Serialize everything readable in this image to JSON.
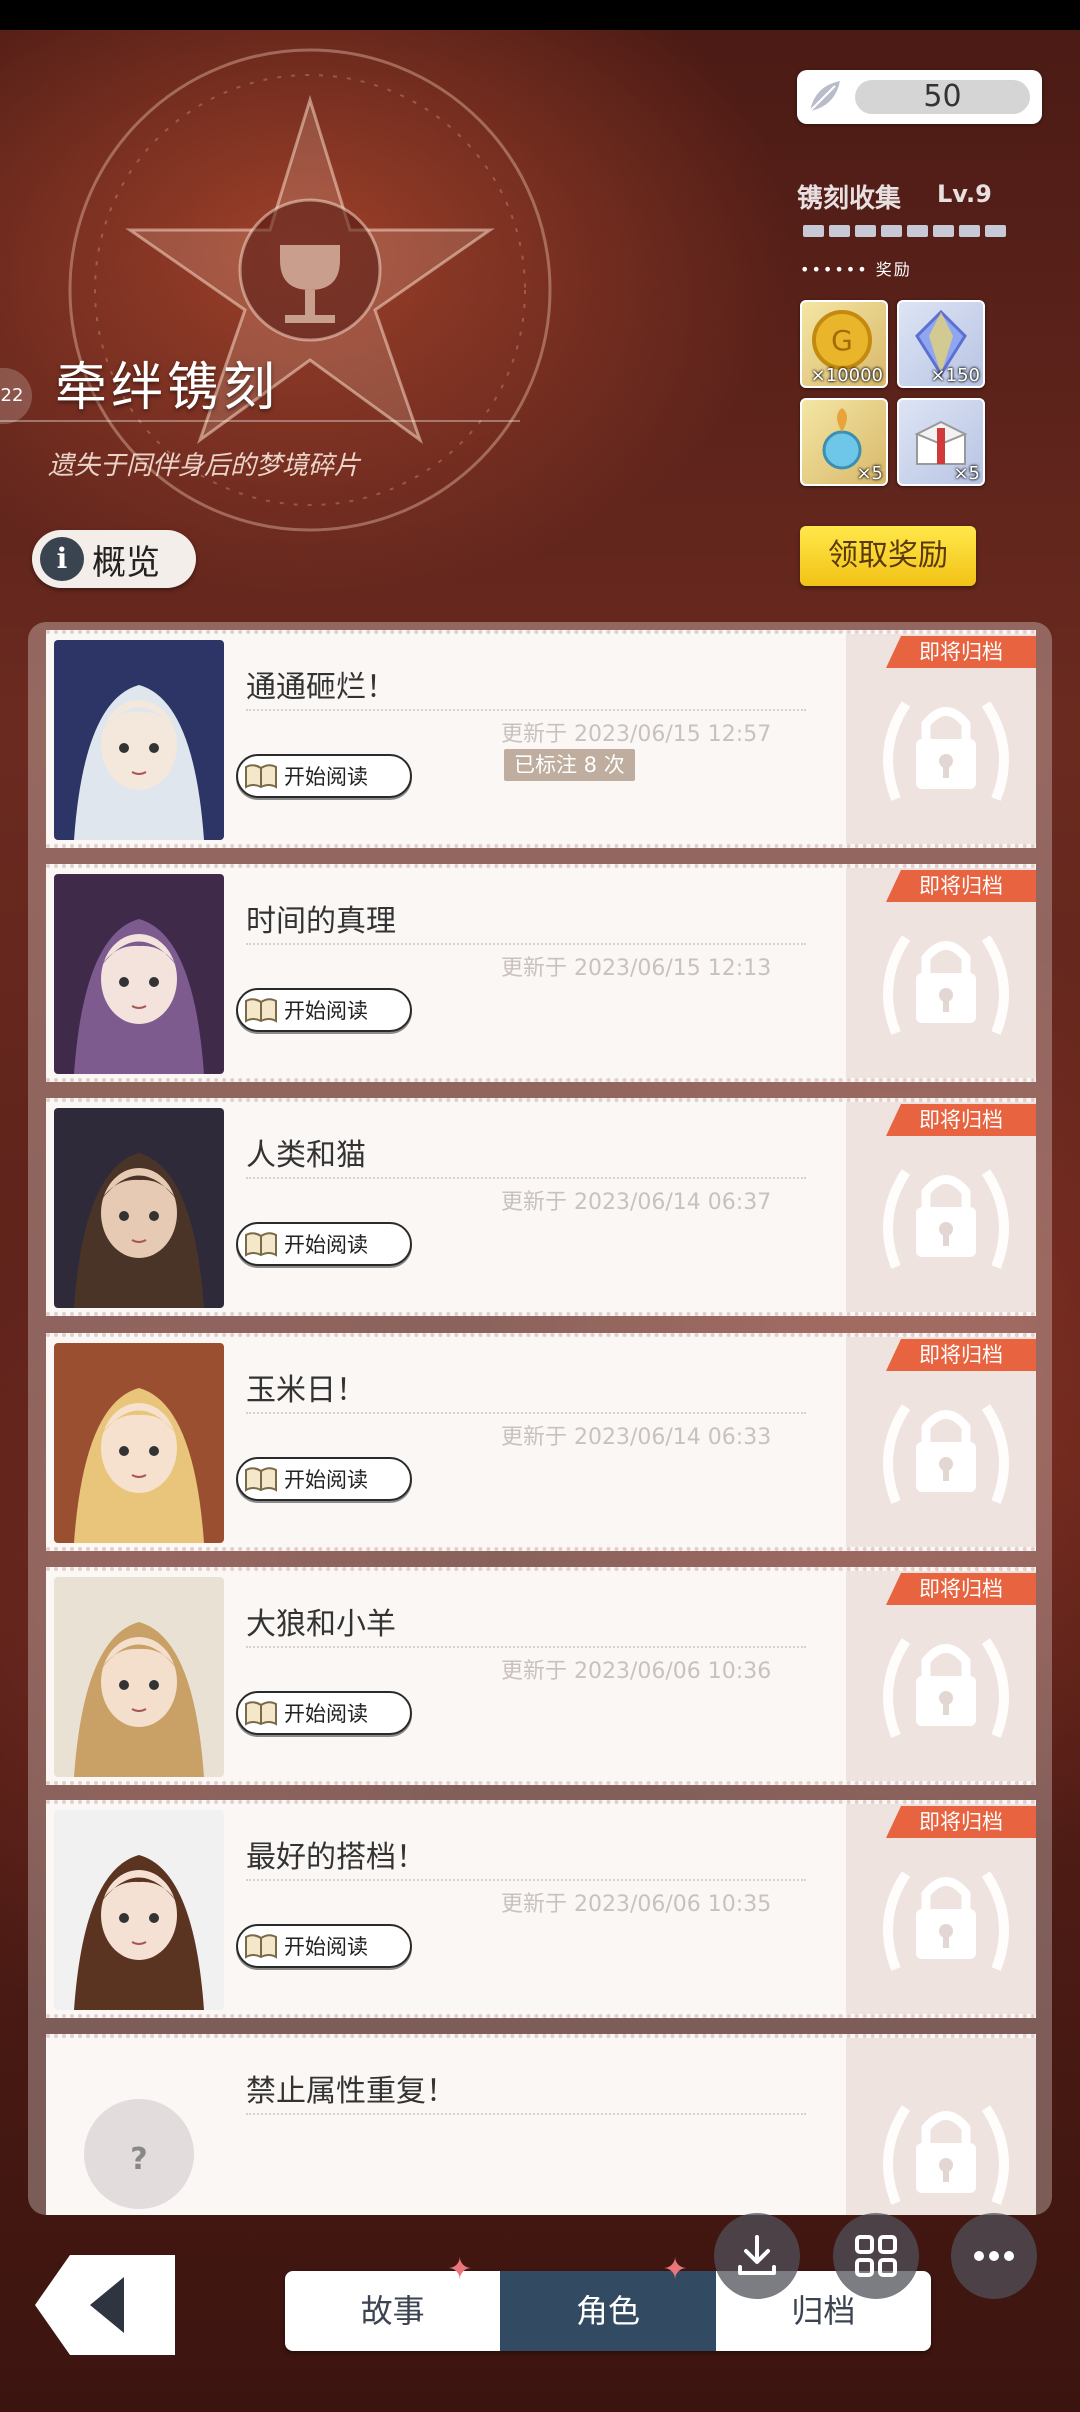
{
  "header": {
    "title": "牵绊镌刻",
    "subtitle": "遗失于同伴身后的梦境碎片",
    "side_badge": "22",
    "overview_label": "概览"
  },
  "currency": {
    "value": "50"
  },
  "collection": {
    "title": "镌刻收集",
    "level": "Lv.9",
    "progress_pips": 8,
    "reward_label": "奖励",
    "rewards": [
      {
        "icon": "gold-coin-icon",
        "count": "×10000"
      },
      {
        "icon": "crystal-icon",
        "count": "×150"
      },
      {
        "icon": "orb-charm-icon",
        "count": "×5"
      },
      {
        "icon": "gift-box-icon",
        "count": "×5"
      }
    ],
    "claim_label": "领取奖励"
  },
  "stories": [
    {
      "title": "通通砸烂！",
      "date": "更新于 2023/06/15 12:57",
      "read_label": "开始阅读",
      "marked": "已标注 8 次",
      "ribbon": "即将归档",
      "portrait": "silver-hair-crown"
    },
    {
      "title": "时间的真理",
      "date": "更新于 2023/06/15 12:13",
      "read_label": "开始阅读",
      "ribbon": "即将归档",
      "portrait": "purple-hair"
    },
    {
      "title": "人类和猫",
      "date": "更新于 2023/06/14 06:37",
      "read_label": "开始阅读",
      "ribbon": "即将归档",
      "portrait": "dark-hood"
    },
    {
      "title": "玉米日！",
      "date": "更新于 2023/06/14 06:33",
      "read_label": "开始阅读",
      "ribbon": "即将归档",
      "portrait": "blonde-braids"
    },
    {
      "title": "大狼和小羊",
      "date": "更新于 2023/06/06 10:36",
      "read_label": "开始阅读",
      "ribbon": "即将归档",
      "portrait": "nun-scarf"
    },
    {
      "title": "最好的搭档！",
      "date": "更新于 2023/06/06 10:35",
      "read_label": "开始阅读",
      "ribbon": "即将归档",
      "portrait": "twin-tails"
    },
    {
      "title": "禁止属性重复！",
      "date": "",
      "read_label": "",
      "ribbon": "",
      "portrait": "unknown"
    }
  ],
  "tabs": [
    {
      "label": "故事",
      "active": false,
      "sparkle": true
    },
    {
      "label": "角色",
      "active": true,
      "sparkle": true
    },
    {
      "label": "归档",
      "active": false,
      "sparkle": false
    }
  ],
  "colors": {
    "ribbon": "#e8633f",
    "active_tab": "#324b63",
    "claim": "#f2c216"
  }
}
